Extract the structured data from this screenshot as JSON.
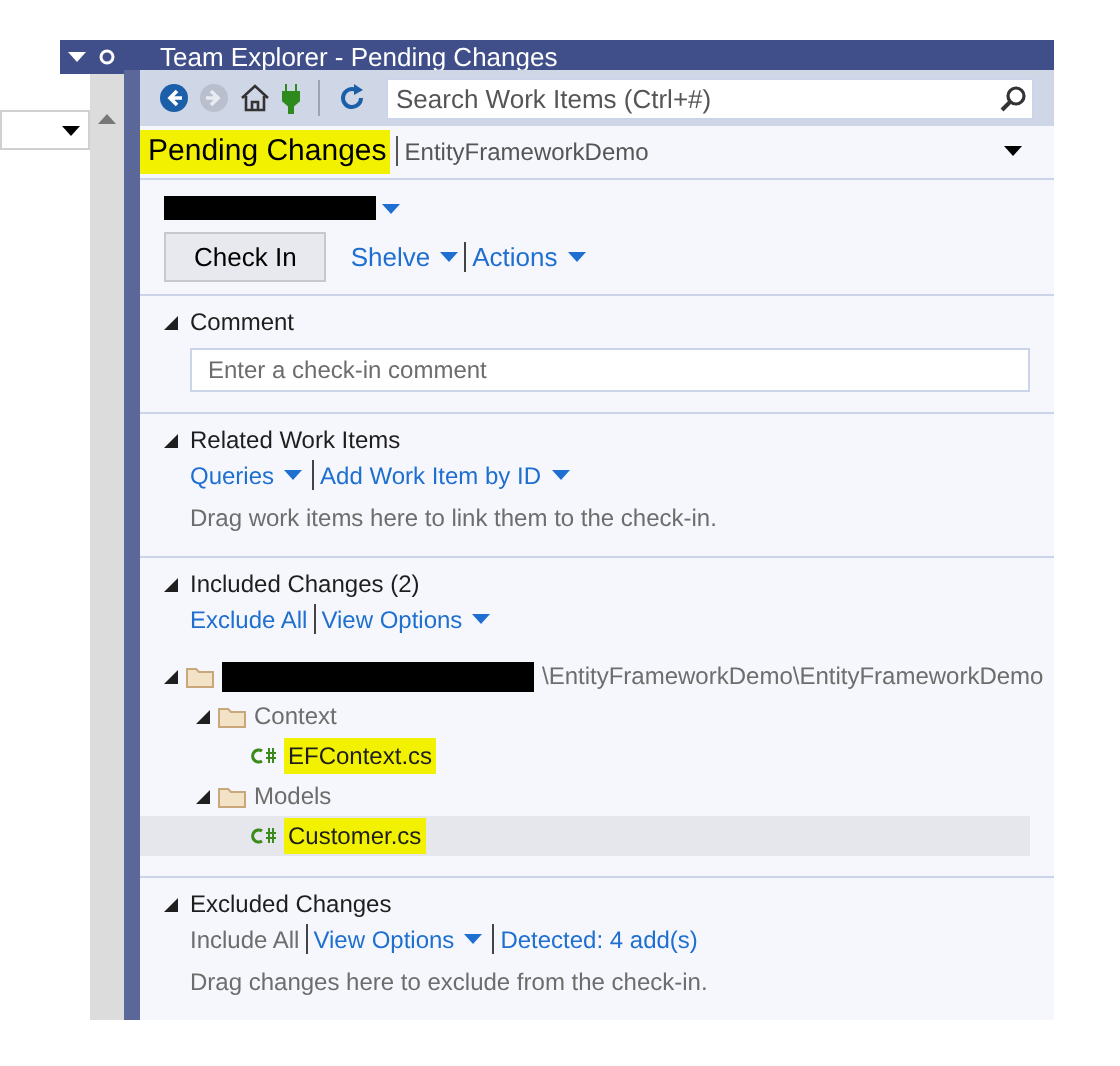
{
  "window": {
    "title": "Team Explorer - Pending Changes"
  },
  "toolbar": {
    "search": {
      "placeholder": "Search Work Items (Ctrl+#)"
    }
  },
  "header": {
    "title": "Pending Changes",
    "highlighted": true,
    "project": "EntityFrameworkDemo"
  },
  "actions": {
    "primary": "Check In",
    "links": [
      "Shelve",
      "Actions"
    ]
  },
  "sections": [
    {
      "kind": "comment",
      "title": "Comment",
      "expanded": true,
      "placeholder": "Enter a check-in comment"
    },
    {
      "kind": "links",
      "title": "Related Work Items",
      "expanded": true,
      "links": [
        {
          "label": "Queries",
          "dropdown": true,
          "enabled": true
        },
        {
          "label": "Add Work Item by ID",
          "dropdown": true,
          "enabled": true
        }
      ],
      "hint": "Drag work items here to link them to the check-in."
    },
    {
      "kind": "tree",
      "title": "Included Changes (2)",
      "expanded": true,
      "links": [
        {
          "label": "Exclude All",
          "dropdown": false,
          "enabled": true
        },
        {
          "label": "View Options",
          "dropdown": true,
          "enabled": true
        }
      ],
      "tree": [
        {
          "kind": "folder",
          "label": "\\EntityFrameworkDemo\\EntityFrameworkDemo",
          "redacted": true,
          "expanded": true,
          "selected": false,
          "highlighted": false,
          "children": [
            {
              "kind": "folder",
              "label": "Context",
              "redacted": false,
              "expanded": true,
              "selected": false,
              "highlighted": false,
              "children": [
                {
                  "kind": "csharp",
                  "label": "EFContext.cs",
                  "redacted": false,
                  "selected": false,
                  "highlighted": true
                }
              ]
            },
            {
              "kind": "folder",
              "label": "Models",
              "redacted": false,
              "expanded": true,
              "selected": false,
              "highlighted": false,
              "children": [
                {
                  "kind": "csharp",
                  "label": "Customer.cs",
                  "redacted": false,
                  "selected": true,
                  "highlighted": true
                }
              ]
            }
          ]
        }
      ]
    },
    {
      "kind": "links",
      "title": "Excluded Changes",
      "expanded": true,
      "links": [
        {
          "label": "Include All",
          "dropdown": false,
          "enabled": false
        },
        {
          "label": "View Options",
          "dropdown": true,
          "enabled": true
        },
        {
          "label": "Detected: 4 add(s)",
          "dropdown": false,
          "enabled": true
        }
      ],
      "hint": "Drag changes here to exclude from the check-in."
    }
  ]
}
